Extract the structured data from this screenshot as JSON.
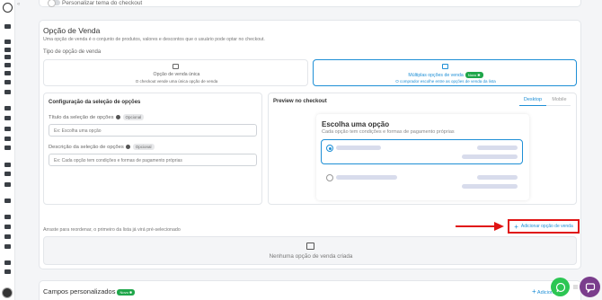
{
  "personalize_toggle": {
    "label": "Personalizar tema do checkout"
  },
  "sale_option": {
    "title": "Opção de Venda",
    "description": "Uma opção de venda é o conjunto de produtos, valores e descontos que o usuário pode optar no checkout.",
    "type_label": "Tipo de opção de venda",
    "types": [
      {
        "title": "Opção de venda única",
        "subtitle": "O checkout vende uma única opção de venda"
      },
      {
        "title": "Múltiplas opções de venda",
        "badge": "Novo ✱",
        "subtitle": "O comprador escolhe entre as opções de venda da lista"
      }
    ]
  },
  "selection_config": {
    "title": "Configuração da seleção de opções",
    "title_field": {
      "label": "Título da seleção de opções",
      "optional": "Opcional",
      "placeholder": "Ex: Escolha uma opção"
    },
    "desc_field": {
      "label": "Descrição da seleção de opções",
      "optional": "Opcional",
      "placeholder": "Ex: Cada opção tem condições e formas de pagamento próprias"
    }
  },
  "preview": {
    "title": "Preview no checkout",
    "tabs": [
      "Desktop",
      "Mobile"
    ],
    "heading": "Escolha uma opção",
    "subheading": "Cada opção tem condições e formas de pagamento próprias"
  },
  "list": {
    "hint": "Arraste para reordenar, o primeiro da lista já virá pré-selecionado",
    "add_button": "Adicionar opção de venda",
    "empty": "Nenhuma opção de venda criada"
  },
  "custom_fields": {
    "title": "Campos personalizados",
    "badge": "Novo ✱",
    "add_label": "Adicionar"
  },
  "colors": {
    "accent": "#1e8fd6",
    "highlight": "#e01414",
    "new_badge": "#1fa64a",
    "whatsapp": "#2cc653",
    "chat": "#7a3d8c"
  }
}
